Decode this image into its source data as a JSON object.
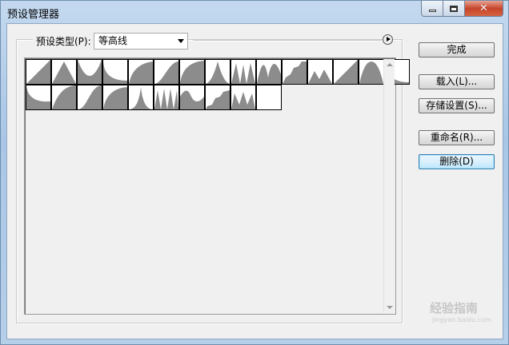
{
  "window": {
    "title": "预设管理器"
  },
  "preset": {
    "label": "预设类型(P):",
    "selected": "等高线"
  },
  "buttons": {
    "done": "完成",
    "load": "载入(L)...",
    "save": "存储设置(S)...",
    "rename": "重命名(R)...",
    "delete": "删除(D)"
  },
  "contours": [
    "linear",
    "cone",
    "cone-inverted",
    "cove-deep",
    "cove-shallow",
    "gaussian",
    "half-round",
    "peak",
    "double-peak",
    "triple-peak",
    "ring",
    "rolling-slope",
    "sawtooth",
    "linear-steep",
    "rounded-steps",
    "valley",
    "cove-flat",
    "gaussian-inverse",
    "s-curve",
    "half-round-steep",
    "cone-narrow",
    "triple-wave",
    "wave",
    "step-slope",
    "double-valley"
  ],
  "watermark": {
    "text": "经验指南",
    "sub": "jingyan.baidu.com"
  }
}
